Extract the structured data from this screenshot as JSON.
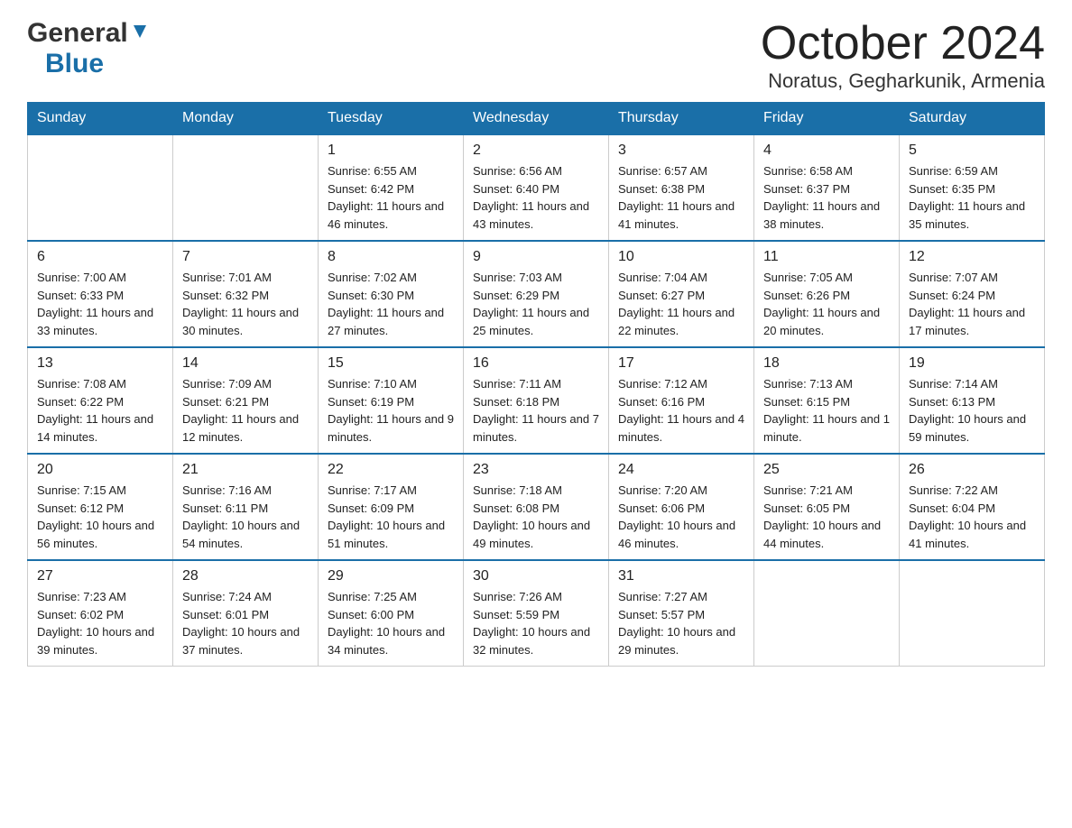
{
  "header": {
    "logo_general": "General",
    "logo_blue": "Blue",
    "title": "October 2024",
    "subtitle": "Noratus, Gegharkunik, Armenia"
  },
  "calendar": {
    "days_of_week": [
      "Sunday",
      "Monday",
      "Tuesday",
      "Wednesday",
      "Thursday",
      "Friday",
      "Saturday"
    ],
    "weeks": [
      [
        {
          "day": "",
          "sunrise": "",
          "sunset": "",
          "daylight": ""
        },
        {
          "day": "",
          "sunrise": "",
          "sunset": "",
          "daylight": ""
        },
        {
          "day": "1",
          "sunrise": "Sunrise: 6:55 AM",
          "sunset": "Sunset: 6:42 PM",
          "daylight": "Daylight: 11 hours and 46 minutes."
        },
        {
          "day": "2",
          "sunrise": "Sunrise: 6:56 AM",
          "sunset": "Sunset: 6:40 PM",
          "daylight": "Daylight: 11 hours and 43 minutes."
        },
        {
          "day": "3",
          "sunrise": "Sunrise: 6:57 AM",
          "sunset": "Sunset: 6:38 PM",
          "daylight": "Daylight: 11 hours and 41 minutes."
        },
        {
          "day": "4",
          "sunrise": "Sunrise: 6:58 AM",
          "sunset": "Sunset: 6:37 PM",
          "daylight": "Daylight: 11 hours and 38 minutes."
        },
        {
          "day": "5",
          "sunrise": "Sunrise: 6:59 AM",
          "sunset": "Sunset: 6:35 PM",
          "daylight": "Daylight: 11 hours and 35 minutes."
        }
      ],
      [
        {
          "day": "6",
          "sunrise": "Sunrise: 7:00 AM",
          "sunset": "Sunset: 6:33 PM",
          "daylight": "Daylight: 11 hours and 33 minutes."
        },
        {
          "day": "7",
          "sunrise": "Sunrise: 7:01 AM",
          "sunset": "Sunset: 6:32 PM",
          "daylight": "Daylight: 11 hours and 30 minutes."
        },
        {
          "day": "8",
          "sunrise": "Sunrise: 7:02 AM",
          "sunset": "Sunset: 6:30 PM",
          "daylight": "Daylight: 11 hours and 27 minutes."
        },
        {
          "day": "9",
          "sunrise": "Sunrise: 7:03 AM",
          "sunset": "Sunset: 6:29 PM",
          "daylight": "Daylight: 11 hours and 25 minutes."
        },
        {
          "day": "10",
          "sunrise": "Sunrise: 7:04 AM",
          "sunset": "Sunset: 6:27 PM",
          "daylight": "Daylight: 11 hours and 22 minutes."
        },
        {
          "day": "11",
          "sunrise": "Sunrise: 7:05 AM",
          "sunset": "Sunset: 6:26 PM",
          "daylight": "Daylight: 11 hours and 20 minutes."
        },
        {
          "day": "12",
          "sunrise": "Sunrise: 7:07 AM",
          "sunset": "Sunset: 6:24 PM",
          "daylight": "Daylight: 11 hours and 17 minutes."
        }
      ],
      [
        {
          "day": "13",
          "sunrise": "Sunrise: 7:08 AM",
          "sunset": "Sunset: 6:22 PM",
          "daylight": "Daylight: 11 hours and 14 minutes."
        },
        {
          "day": "14",
          "sunrise": "Sunrise: 7:09 AM",
          "sunset": "Sunset: 6:21 PM",
          "daylight": "Daylight: 11 hours and 12 minutes."
        },
        {
          "day": "15",
          "sunrise": "Sunrise: 7:10 AM",
          "sunset": "Sunset: 6:19 PM",
          "daylight": "Daylight: 11 hours and 9 minutes."
        },
        {
          "day": "16",
          "sunrise": "Sunrise: 7:11 AM",
          "sunset": "Sunset: 6:18 PM",
          "daylight": "Daylight: 11 hours and 7 minutes."
        },
        {
          "day": "17",
          "sunrise": "Sunrise: 7:12 AM",
          "sunset": "Sunset: 6:16 PM",
          "daylight": "Daylight: 11 hours and 4 minutes."
        },
        {
          "day": "18",
          "sunrise": "Sunrise: 7:13 AM",
          "sunset": "Sunset: 6:15 PM",
          "daylight": "Daylight: 11 hours and 1 minute."
        },
        {
          "day": "19",
          "sunrise": "Sunrise: 7:14 AM",
          "sunset": "Sunset: 6:13 PM",
          "daylight": "Daylight: 10 hours and 59 minutes."
        }
      ],
      [
        {
          "day": "20",
          "sunrise": "Sunrise: 7:15 AM",
          "sunset": "Sunset: 6:12 PM",
          "daylight": "Daylight: 10 hours and 56 minutes."
        },
        {
          "day": "21",
          "sunrise": "Sunrise: 7:16 AM",
          "sunset": "Sunset: 6:11 PM",
          "daylight": "Daylight: 10 hours and 54 minutes."
        },
        {
          "day": "22",
          "sunrise": "Sunrise: 7:17 AM",
          "sunset": "Sunset: 6:09 PM",
          "daylight": "Daylight: 10 hours and 51 minutes."
        },
        {
          "day": "23",
          "sunrise": "Sunrise: 7:18 AM",
          "sunset": "Sunset: 6:08 PM",
          "daylight": "Daylight: 10 hours and 49 minutes."
        },
        {
          "day": "24",
          "sunrise": "Sunrise: 7:20 AM",
          "sunset": "Sunset: 6:06 PM",
          "daylight": "Daylight: 10 hours and 46 minutes."
        },
        {
          "day": "25",
          "sunrise": "Sunrise: 7:21 AM",
          "sunset": "Sunset: 6:05 PM",
          "daylight": "Daylight: 10 hours and 44 minutes."
        },
        {
          "day": "26",
          "sunrise": "Sunrise: 7:22 AM",
          "sunset": "Sunset: 6:04 PM",
          "daylight": "Daylight: 10 hours and 41 minutes."
        }
      ],
      [
        {
          "day": "27",
          "sunrise": "Sunrise: 7:23 AM",
          "sunset": "Sunset: 6:02 PM",
          "daylight": "Daylight: 10 hours and 39 minutes."
        },
        {
          "day": "28",
          "sunrise": "Sunrise: 7:24 AM",
          "sunset": "Sunset: 6:01 PM",
          "daylight": "Daylight: 10 hours and 37 minutes."
        },
        {
          "day": "29",
          "sunrise": "Sunrise: 7:25 AM",
          "sunset": "Sunset: 6:00 PM",
          "daylight": "Daylight: 10 hours and 34 minutes."
        },
        {
          "day": "30",
          "sunrise": "Sunrise: 7:26 AM",
          "sunset": "Sunset: 5:59 PM",
          "daylight": "Daylight: 10 hours and 32 minutes."
        },
        {
          "day": "31",
          "sunrise": "Sunrise: 7:27 AM",
          "sunset": "Sunset: 5:57 PM",
          "daylight": "Daylight: 10 hours and 29 minutes."
        },
        {
          "day": "",
          "sunrise": "",
          "sunset": "",
          "daylight": ""
        },
        {
          "day": "",
          "sunrise": "",
          "sunset": "",
          "daylight": ""
        }
      ]
    ]
  }
}
